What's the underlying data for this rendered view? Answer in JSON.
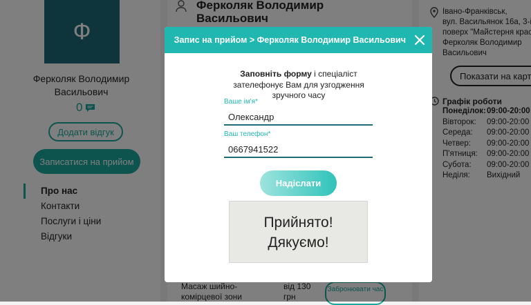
{
  "doctor": {
    "avatar_letter": "Ф",
    "name": "Ферколяк Володимир Васильович",
    "rating_count": "0",
    "add_review_label": "Додати відгук",
    "book_label": "Записатися на прийом"
  },
  "side_nav": [
    "Про нас",
    "Контакти",
    "Послуги і ціни",
    "Відгуки"
  ],
  "main": {
    "title": "Ферколяк Володимир Васильович",
    "service_name": "Масаж шийно-комірцевої зони",
    "service_price": "від 130 грн",
    "reserve_label": "Забронювати час"
  },
  "location": {
    "address_lines": [
      "Івано-Франківськ,",
      "вул. Васильянок 16а, 3-й",
      "поверх \"Майстерня краси",
      "Ферколяк Володимир",
      "Васильович"
    ],
    "show_map_label": "Показати на карті"
  },
  "schedule": {
    "title": "Графік роботи",
    "rows": [
      {
        "day": "Понеділок:",
        "hours": "09:00-20:00"
      },
      {
        "day": "Вівторок:",
        "hours": "09:00-20:00"
      },
      {
        "day": "Середа:",
        "hours": "09:00-20:00"
      },
      {
        "day": "Четвер:",
        "hours": "09:00-20:00"
      },
      {
        "day": "П'ятниця:",
        "hours": "09:00-20:00"
      },
      {
        "day": "Субота:",
        "hours": "09:00-20:00"
      },
      {
        "day": "Неділя:",
        "hours": "Вихідний"
      }
    ]
  },
  "modal": {
    "title": "Запис на прийом > Ферколяк Володимир Васильович",
    "intro_bold": "Заповніть форму",
    "intro_rest": " і спеціаліст зателефонує Вам для узгодження зручного часу",
    "name_label": "Ваше ім'я*",
    "name_value": "Олександр",
    "phone_label": "Ваш телефон*",
    "phone_value": "0667941522",
    "submit_label": "Надіслати",
    "success_line1": "Прийнято!",
    "success_line2": "Дякуємо!"
  },
  "colors": {
    "accent": "#1fb7b0",
    "dark_teal": "#1e6a78"
  }
}
